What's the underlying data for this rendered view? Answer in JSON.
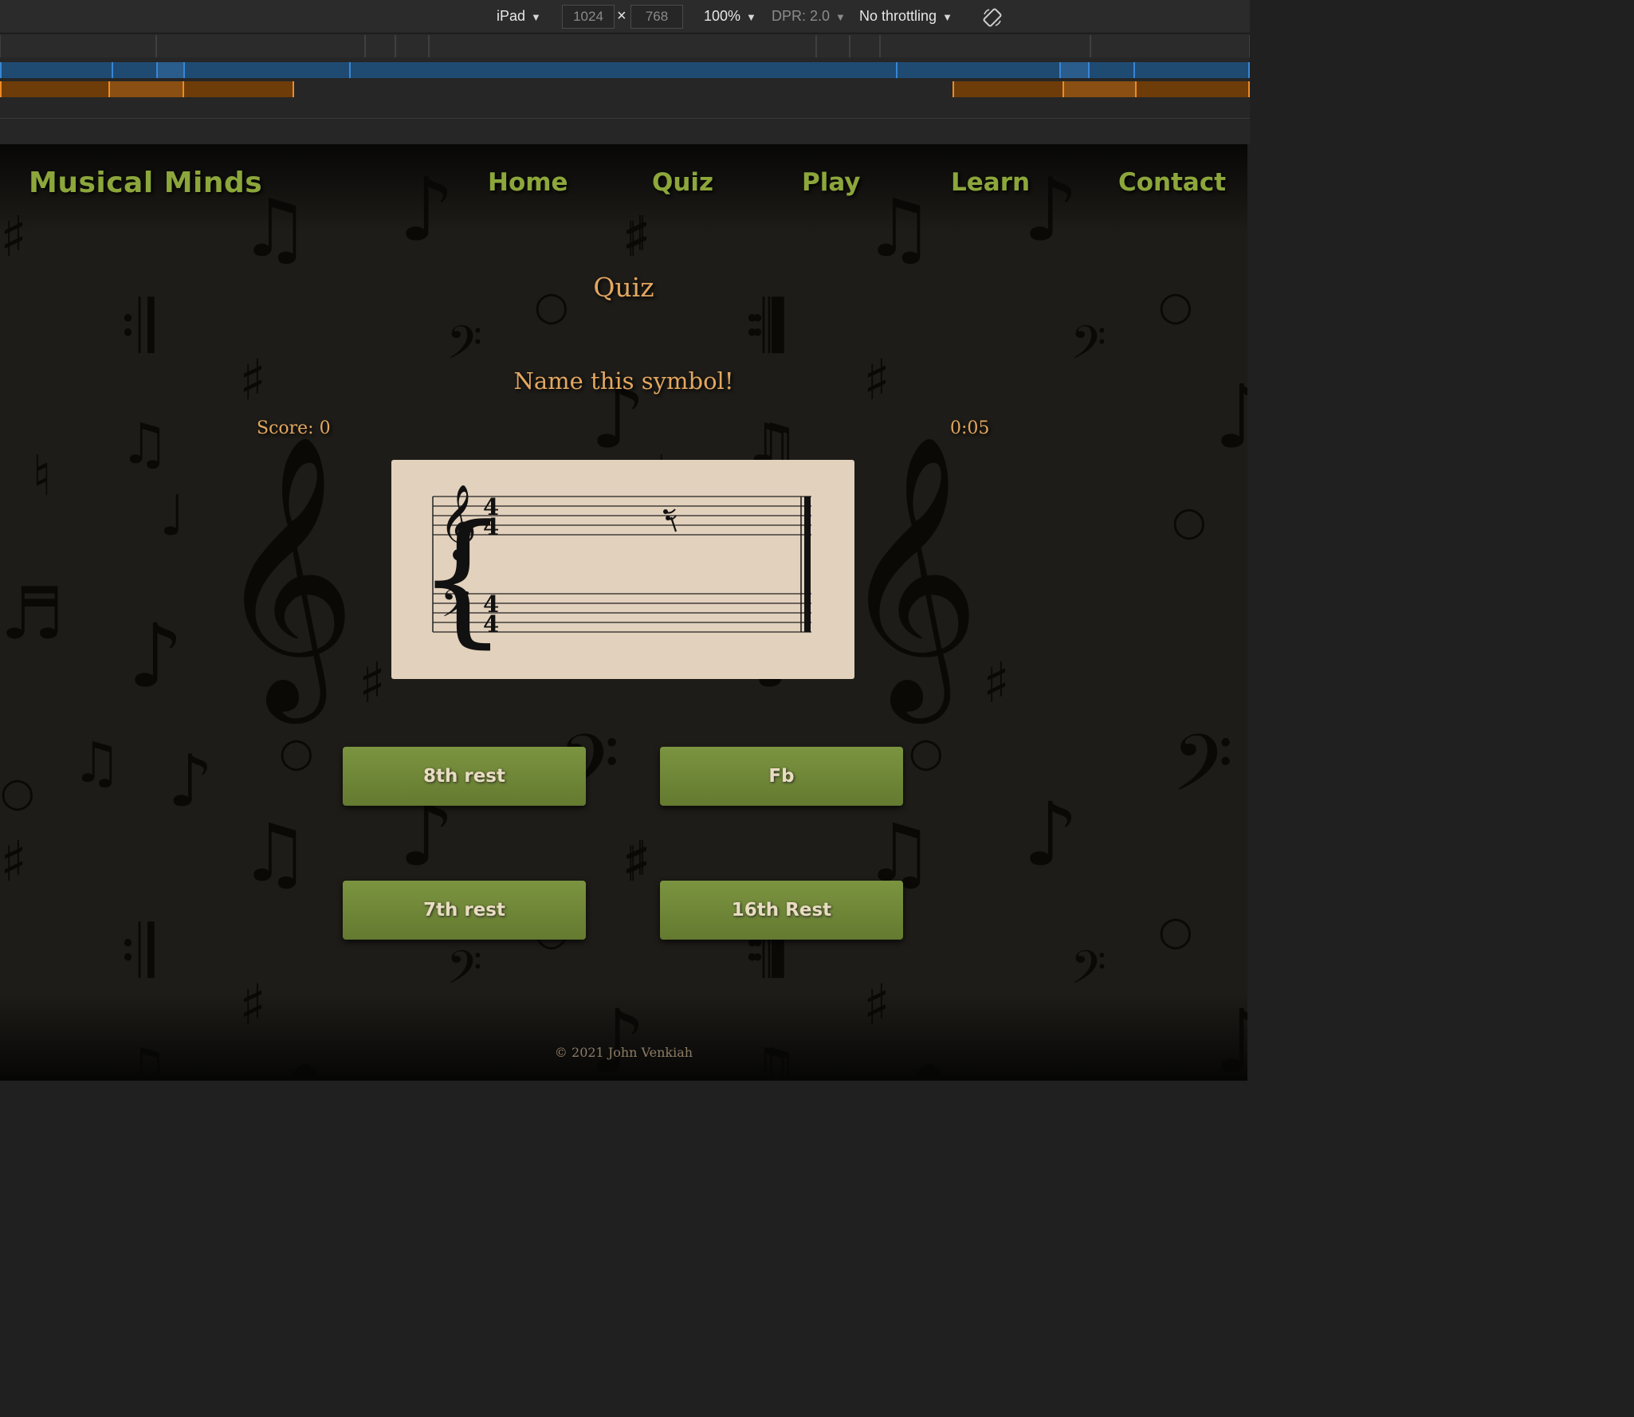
{
  "devtools": {
    "device": "iPad",
    "width": "1024",
    "height": "768",
    "times": "×",
    "zoom": "100%",
    "dpr": "DPR: 2.0",
    "throttling": "No throttling",
    "caret": "▼",
    "rotate_icon": "rotate-icon"
  },
  "site": {
    "brand": "Musical Minds",
    "nav": [
      "Home",
      "Quiz",
      "Play",
      "Learn",
      "Contact"
    ],
    "quiz_title": "Quiz",
    "prompt": "Name this symbol!",
    "score": "Score: 0",
    "timer": "0:05",
    "staff_symbol": "16th-rest",
    "answers": [
      "8th rest",
      "Fb",
      "7th rest",
      "16th Rest"
    ],
    "footer": "© 2021 John Venkiah"
  },
  "colors": {
    "brand_green": "#8ca63b",
    "button_green": "#6f8736",
    "gold_text": "#e2a760",
    "card_bg": "#e2d1bc",
    "page_bg": "#1e1c18"
  }
}
